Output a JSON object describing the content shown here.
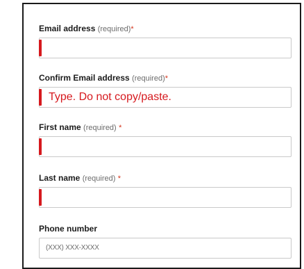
{
  "form": {
    "email": {
      "label": "Email address",
      "required_text": "(required)",
      "required_mark": "*",
      "value": ""
    },
    "confirm_email": {
      "label": "Confirm Email address",
      "required_text": "(required)",
      "required_mark": "*",
      "value": "Type. Do not copy/paste."
    },
    "first_name": {
      "label": "First name",
      "required_text": "(required)",
      "required_mark": "*",
      "value": ""
    },
    "last_name": {
      "label": "Last name",
      "required_text": "(required)",
      "required_mark": "*",
      "value": ""
    },
    "phone": {
      "label": "Phone number",
      "placeholder": "(XXX) XXX-XXXX",
      "value": ""
    }
  },
  "colors": {
    "error": "#d6191e",
    "required_mark": "#d4351c",
    "input_border": "#c9c9c9",
    "frame_border": "#1a1a1a"
  }
}
